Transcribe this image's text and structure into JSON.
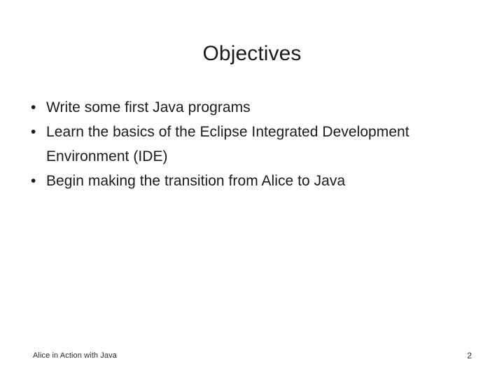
{
  "slide": {
    "title": "Objectives",
    "bullet_marker": "•",
    "bullets": [
      {
        "text": "Write some first Java programs"
      },
      {
        "text": "Learn the basics of the Eclipse Integrated Development Environment (IDE)"
      },
      {
        "text": "Begin making the transition from Alice to Java"
      }
    ],
    "footer": {
      "note": "Alice in Action with Java",
      "page_number": "2"
    },
    "colors": {
      "background": "#ffffff",
      "text": "#1a1a1a",
      "footer_text": "#2b2b2b"
    }
  }
}
